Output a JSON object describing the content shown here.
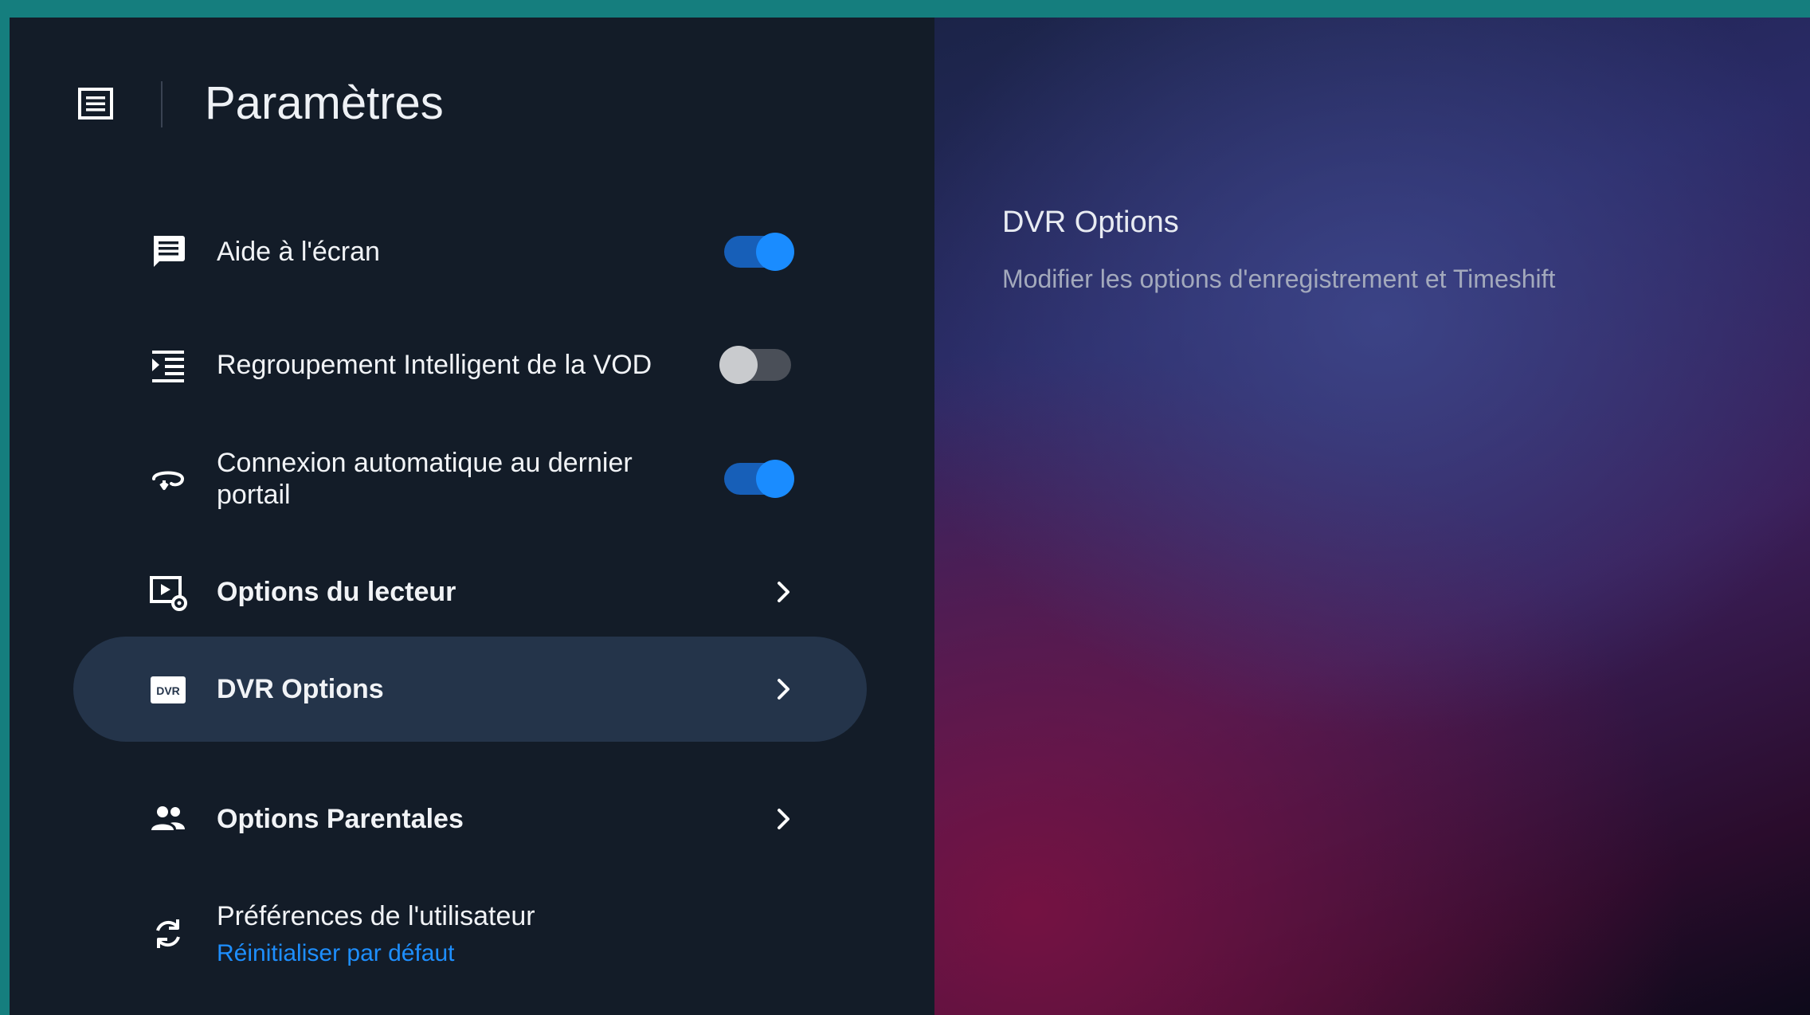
{
  "header": {
    "title": "Paramètres",
    "icon": "list-icon"
  },
  "settings": {
    "items": [
      {
        "label": "Aide à l'écran",
        "icon": "comment-icon",
        "control": "toggle",
        "enabled": true
      },
      {
        "label": "Regroupement Intelligent de la VOD",
        "icon": "indent-list-icon",
        "control": "toggle",
        "enabled": false
      },
      {
        "label": "Connexion automatique au dernier portail",
        "icon": "connect-loop-icon",
        "control": "toggle",
        "enabled": true
      },
      {
        "label": "Options du lecteur",
        "icon": "player-settings-icon",
        "control": "submenu"
      },
      {
        "label": "DVR Options",
        "icon": "dvr-icon",
        "control": "submenu",
        "selected": true
      },
      {
        "label": "Options Parentales",
        "icon": "people-icon",
        "control": "submenu"
      },
      {
        "label": "Préférences de l'utilisateur",
        "sublabel": "Réinitialiser par défaut",
        "icon": "sync-icon",
        "control": "action"
      }
    ]
  },
  "preview": {
    "title": "DVR Options",
    "description": "Modifier les options d'enregistrement et Timeshift"
  },
  "colors": {
    "frame": "#157e7e",
    "panel_bg": "#131c28",
    "selected_row": "#24344a",
    "toggle_on": "#1a8cff",
    "toggle_off": "#c9cbce",
    "link": "#1e8fff"
  }
}
